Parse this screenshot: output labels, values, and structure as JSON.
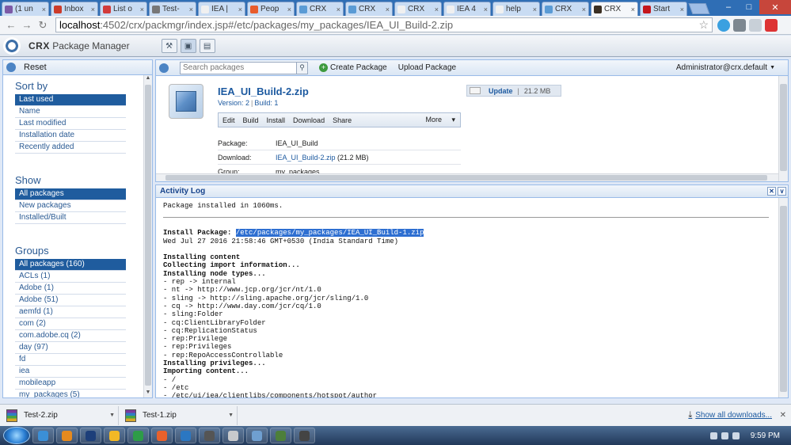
{
  "browser": {
    "tabs": [
      {
        "label": "(1 un",
        "color": "#7c5aa6"
      },
      {
        "label": "Inbox",
        "color": "#cc3b2a"
      },
      {
        "label": "List o",
        "color": "#d23b3b"
      },
      {
        "label": "Test-",
        "color": "#777777"
      },
      {
        "label": "IEA |",
        "color": "#f0f0f0"
      },
      {
        "label": "Peop",
        "color": "#e85c2c"
      },
      {
        "label": "CRX",
        "color": "#5a9bd5"
      },
      {
        "label": "CRX",
        "color": "#5a9bd5"
      },
      {
        "label": "CRX",
        "color": "#f0f0f0"
      },
      {
        "label": "IEA 4",
        "color": "#f0f0f0"
      },
      {
        "label": "help",
        "color": "#f0f0f0"
      },
      {
        "label": "CRX",
        "color": "#5a9bd5"
      },
      {
        "label": "CRX",
        "color": "#3b2f23",
        "active": true
      },
      {
        "label": "Start",
        "color": "#c4161c"
      }
    ],
    "url_host": "localhost",
    "url_path": ":4502/crx/packmgr/index.jsp#/etc/packages/my_packages/IEA_UI_Build-2.zip"
  },
  "crx": {
    "brand": "CRX",
    "title": "Package Manager"
  },
  "left": {
    "reset_label": "Reset",
    "sort_title": "Sort by",
    "sort_items": [
      "Last used",
      "Name",
      "Last modified",
      "Installation date",
      "Recently added"
    ],
    "show_title": "Show",
    "show_items": [
      "All packages",
      "New packages",
      "Installed/Built"
    ],
    "groups_title": "Groups",
    "group_items": [
      "All packages (160)",
      "ACLs (1)",
      "Adobe (1)",
      "Adobe (51)",
      "aemfd (1)",
      "com (2)",
      "com.adobe.cq (2)",
      "day (97)",
      "fd",
      "iea",
      "mobileapp",
      "my_packages (5)"
    ]
  },
  "toolbar": {
    "search_placeholder": "Search packages",
    "create_label": "Create Package",
    "upload_label": "Upload Package",
    "user_label": "Administrator@crx.default"
  },
  "package": {
    "name": "IEA_UI_Build-2.zip",
    "version": "Version: 2",
    "build": "Build: 1",
    "actions": [
      "Edit",
      "Build",
      "Install",
      "Download",
      "Share"
    ],
    "more_label": "More",
    "update_label": "Update",
    "update_size": "21.2 MB",
    "rows": [
      {
        "key": "Package:",
        "value": "IEA_UI_Build"
      },
      {
        "key": "Download:",
        "link": "IEA_UI_Build-2.zip",
        "value": " (21.2 MB)"
      },
      {
        "key": "Group:",
        "value": "my_packages"
      }
    ]
  },
  "log": {
    "title": "Activity Log",
    "installed_msg": "Package installed in 1060ms.",
    "install_label": "Install Package:",
    "install_path": "/etc/packages/my_packages/IEA_UI_Build-1.zip",
    "date": "Wed Jul 27 2016 21:58:46 GMT+0530 (India Standard Time)",
    "lines": [
      {
        "t": "Installing content",
        "b": true
      },
      {
        "t": "Collecting import information...",
        "b": true
      },
      {
        "t": "Installing node types...",
        "b": true
      },
      {
        "t": "- rep -> internal",
        "b": false
      },
      {
        "t": "- nt -> http://www.jcp.org/jcr/nt/1.0",
        "b": false
      },
      {
        "t": "- sling -> http://sling.apache.org/jcr/sling/1.0",
        "b": false
      },
      {
        "t": "- cq -> http://www.day.com/jcr/cq/1.0",
        "b": false
      },
      {
        "t": "- sling:Folder",
        "b": false
      },
      {
        "t": "- cq:ClientLibraryFolder",
        "b": false
      },
      {
        "t": "- cq:ReplicationStatus",
        "b": false
      },
      {
        "t": "- rep:Privilege",
        "b": false
      },
      {
        "t": "- rep:Privileges",
        "b": false
      },
      {
        "t": "- rep:RepoAccessControllable",
        "b": false
      },
      {
        "t": "Installing privileges...",
        "b": true
      },
      {
        "t": "Importing content...",
        "b": true
      },
      {
        "t": "- /",
        "b": false
      },
      {
        "t": "- /etc",
        "b": false
      },
      {
        "t": "- /etc/ui/iea/clientlibs/components/hotspot/author",
        "b": false
      }
    ]
  },
  "downloads": {
    "items": [
      "Test-2.zip",
      "Test-1.zip"
    ],
    "show_all": "Show all downloads..."
  },
  "taskbar": {
    "icons": [
      "#3b8fd6",
      "#e58a1f",
      "#1d3f7a",
      "#f2b825",
      "#2e9c48",
      "#e8612c",
      "#2b77c2",
      "#555555",
      "#c7c9cc",
      "#6f9fd0",
      "#4d7f3a",
      "#444444"
    ],
    "time": "9:59 PM"
  }
}
